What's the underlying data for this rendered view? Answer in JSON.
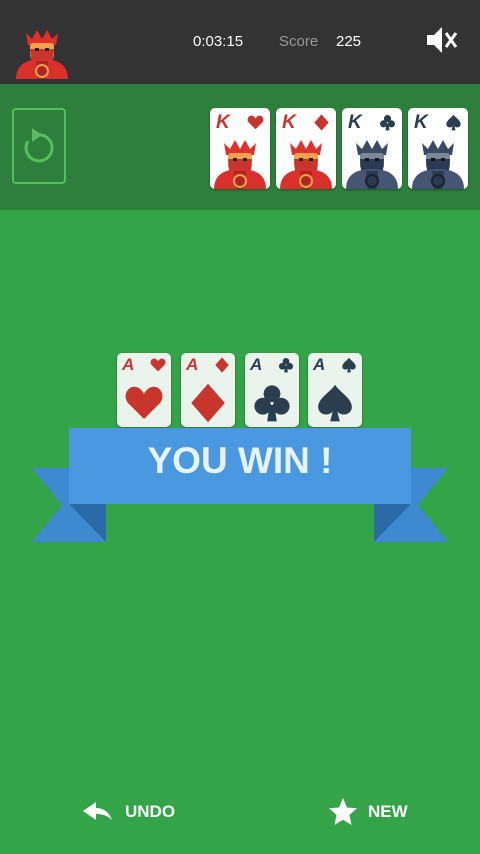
{
  "header": {
    "avatar_icon": "king-avatar-icon",
    "timer": "0:03:15",
    "score_label": "Score",
    "score_value": "225",
    "sound_icon": "volume-muted-icon"
  },
  "stock": {
    "icon": "refresh-icon"
  },
  "foundation_kings": [
    {
      "rank": "K",
      "suit": "hearts",
      "color": "#c8352d"
    },
    {
      "rank": "K",
      "suit": "diamonds",
      "color": "#c8352d"
    },
    {
      "rank": "K",
      "suit": "clubs",
      "color": "#2b3e50"
    },
    {
      "rank": "K",
      "suit": "spades",
      "color": "#2b3e50"
    }
  ],
  "center_aces": [
    {
      "rank": "A",
      "suit": "hearts"
    },
    {
      "rank": "A",
      "suit": "diamonds"
    },
    {
      "rank": "A",
      "suit": "clubs"
    },
    {
      "rank": "A",
      "suit": "spades"
    }
  ],
  "banner": {
    "text": "YOU WIN !",
    "color": "#4a98df"
  },
  "footer": {
    "undo_label": "UNDO",
    "undo_icon": "undo-icon",
    "new_label": "NEW",
    "new_icon": "star-icon"
  },
  "colors": {
    "felt": "#33a447",
    "top_bar": "#333333",
    "stock_bar": "#2e7f3c",
    "red_suit": "#c8352d",
    "dark_suit": "#2b3e50"
  }
}
